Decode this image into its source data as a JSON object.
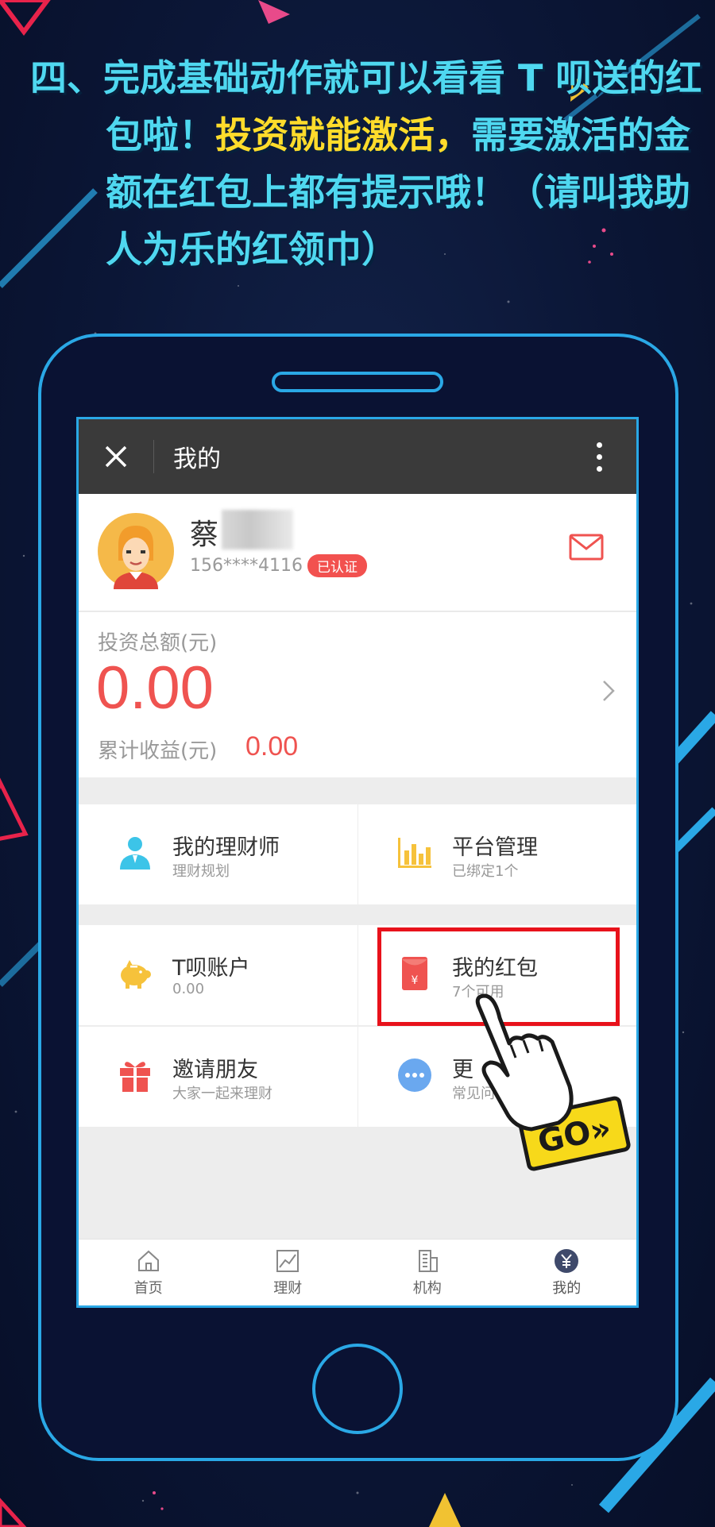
{
  "poster": {
    "line1": "四、完成基础动作就可以看看 T 呗送的红",
    "line2a": "包啦！",
    "line2b": "投资就能激活，",
    "line2c": "需要激活的金",
    "line3": "额在红包上都有提示哦！（请叫我助",
    "line4": "人为乐的红领巾）"
  },
  "topbar": {
    "title": "我的"
  },
  "profile": {
    "name": "蔡",
    "phone": "156****4116",
    "badge": "已认证"
  },
  "assets": {
    "total_label": "投资总额(元)",
    "total_value": "0.00",
    "income_label": "累计收益(元)",
    "income_value": "0.00"
  },
  "tiles": [
    {
      "title": "我的理财师",
      "sub": "理财规划"
    },
    {
      "title": "平台管理",
      "sub": "已绑定1个"
    },
    {
      "title": "T呗账户",
      "sub": "0.00"
    },
    {
      "title": "我的红包",
      "sub": "7个可用"
    },
    {
      "title": "邀请朋友",
      "sub": "大家一起来理财"
    },
    {
      "title": "更",
      "sub": "常见问"
    }
  ],
  "tabbar": [
    {
      "label": "首页"
    },
    {
      "label": "理财"
    },
    {
      "label": "机构"
    },
    {
      "label": "我的"
    }
  ],
  "go_label": "GO»",
  "colors": {
    "accent_red": "#ef5350",
    "highlight": "#e8121b",
    "poster_cyan": "#4fd8f0",
    "poster_yellow": "#ffdc2b",
    "phone_outline": "#2aa8e6"
  }
}
